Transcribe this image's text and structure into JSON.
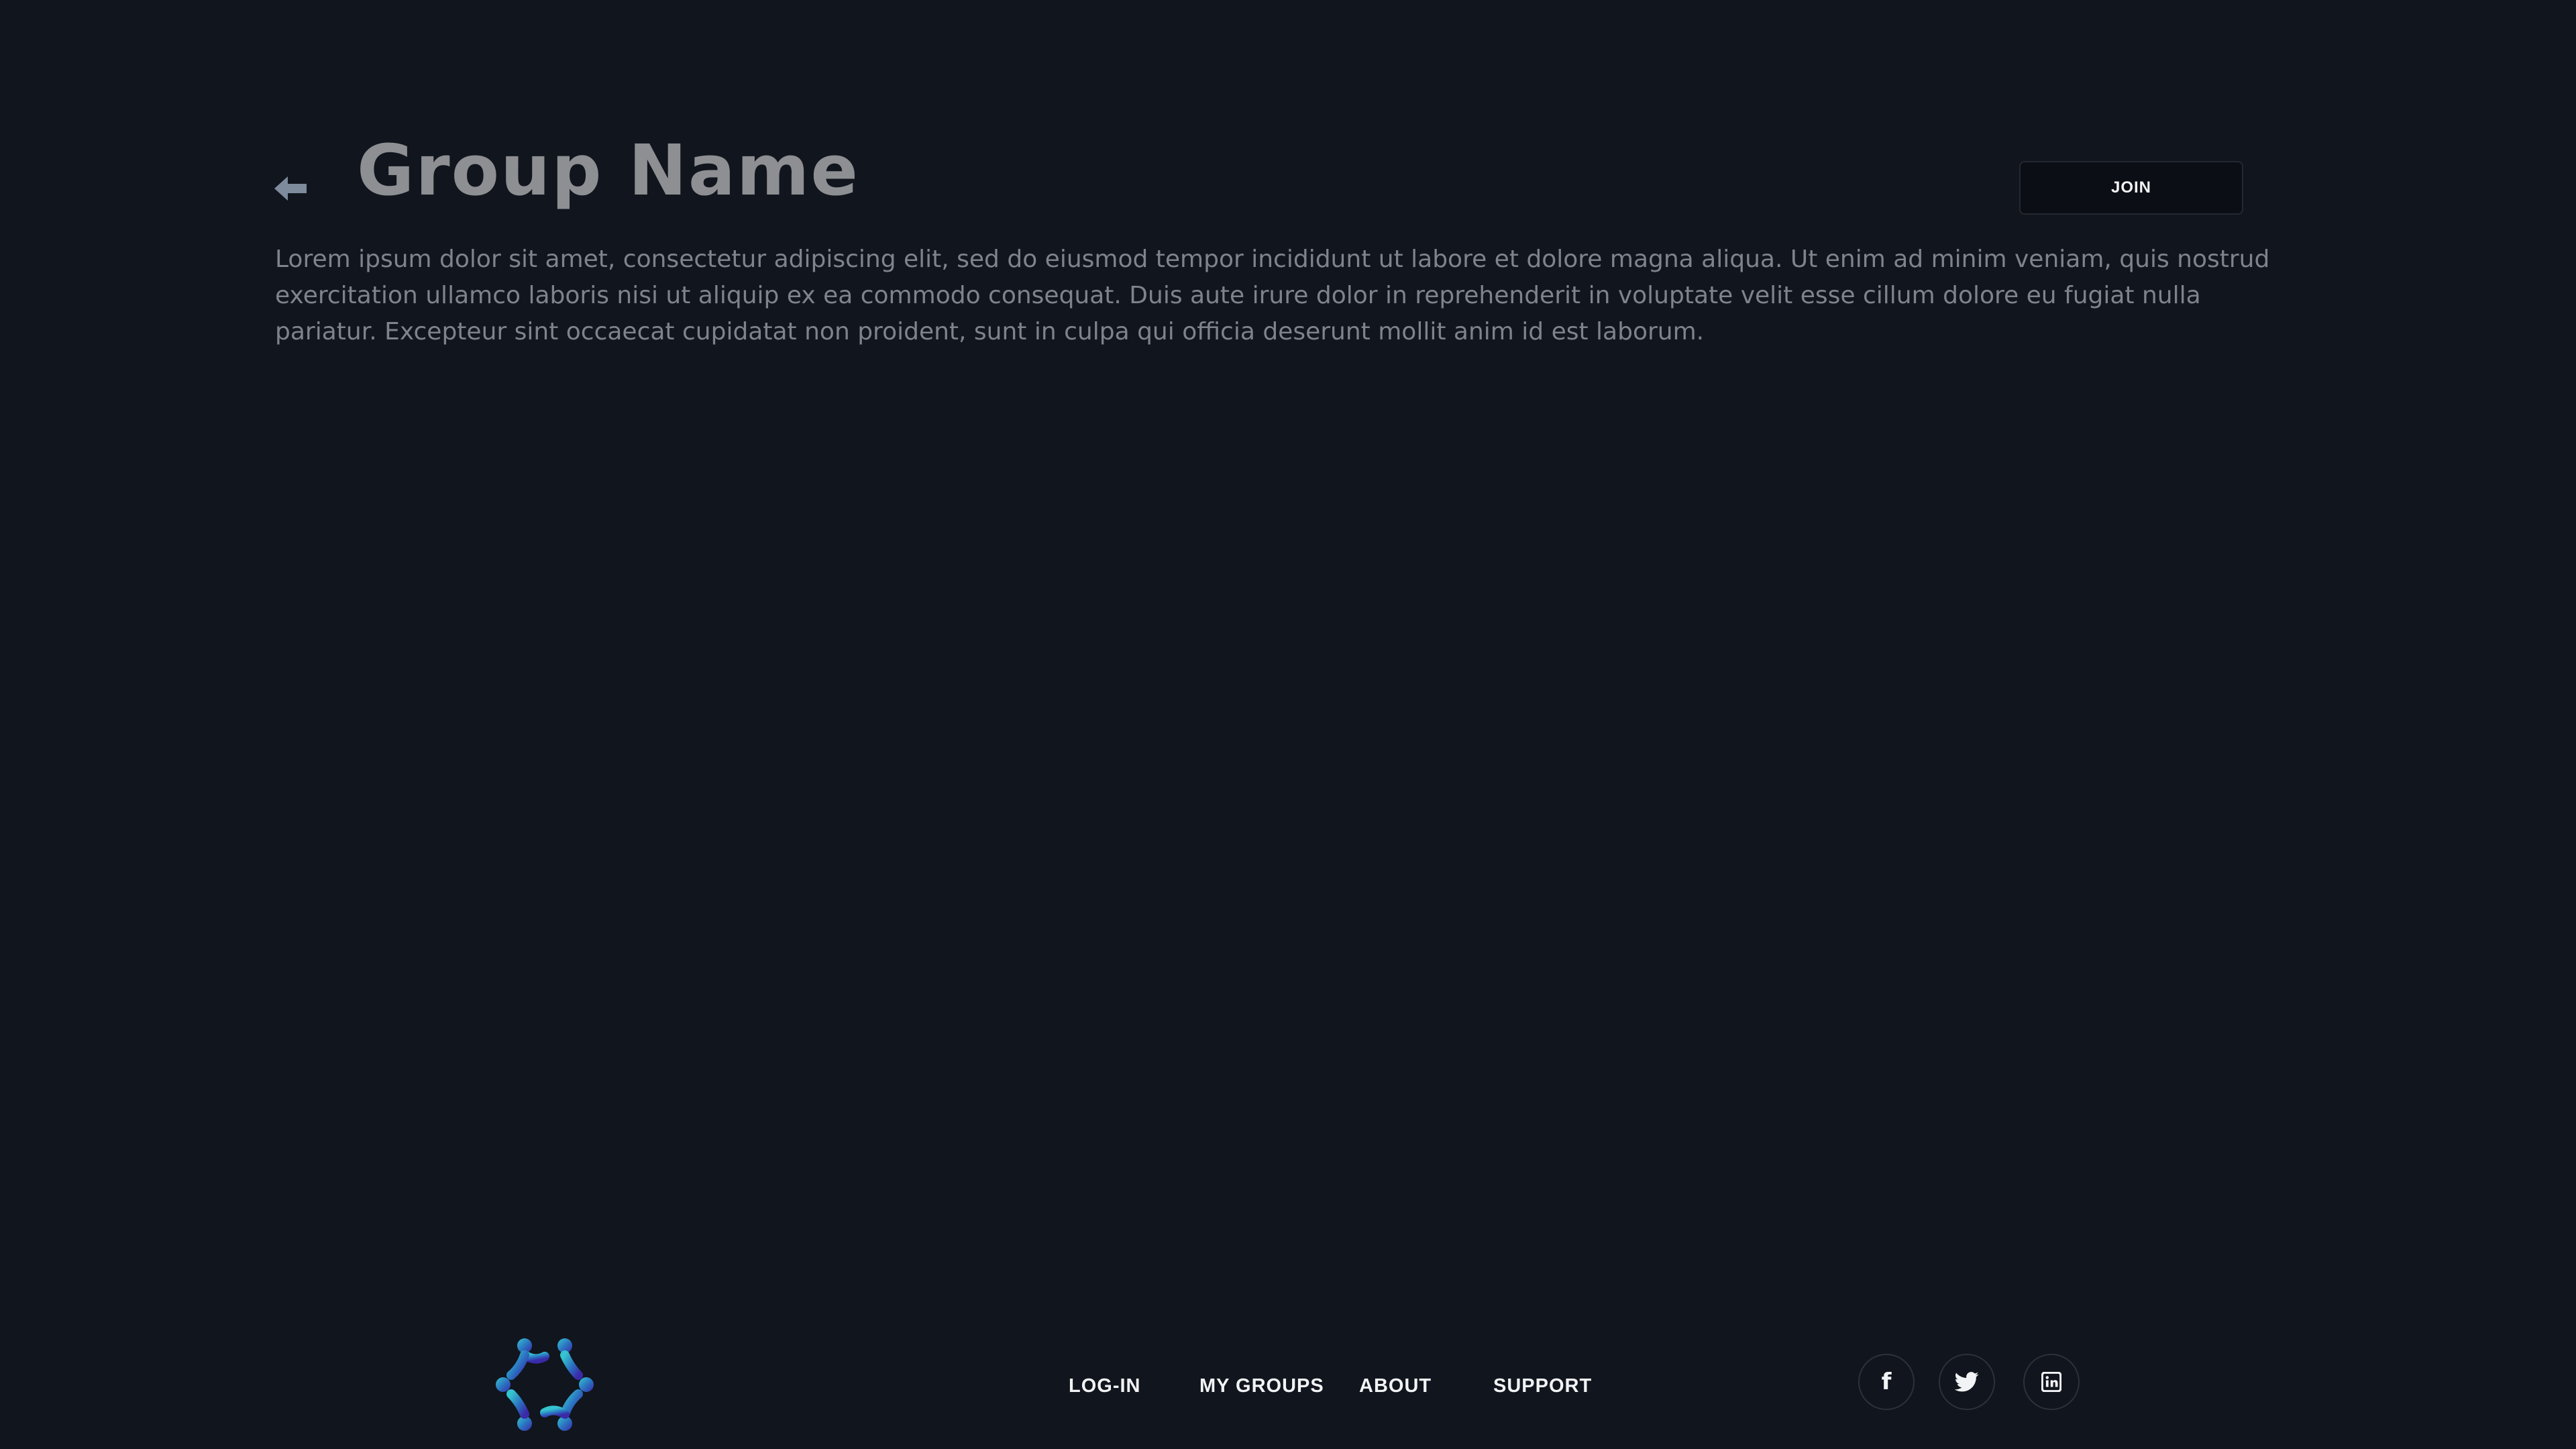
{
  "header": {
    "title": "Group Name",
    "back_icon": "arrow-left-icon",
    "join_label": "JOIN"
  },
  "main": {
    "description": "Lorem ipsum dolor sit amet, consectetur adipiscing elit, sed do eiusmod tempor incididunt ut labore et dolore magna aliqua. Ut enim ad minim veniam, quis nostrud exercitation ullamco laboris nisi ut aliquip ex ea commodo consequat. Duis aute irure dolor in reprehenderit in voluptate velit esse cillum dolore eu fugiat nulla pariatur. Excepteur sint occaecat cupidatat non proident, sunt in culpa qui officia deserunt mollit anim id est laborum."
  },
  "footer": {
    "logo_icon": "community-logo-icon",
    "links": [
      {
        "label": "LOG-IN"
      },
      {
        "label": "MY GROUPS"
      },
      {
        "label": "ABOUT"
      },
      {
        "label": "SUPPORT"
      }
    ],
    "social": [
      {
        "icon": "facebook-icon",
        "glyph": "f"
      },
      {
        "icon": "twitter-icon",
        "glyph": ""
      },
      {
        "icon": "linkedin-icon",
        "glyph": ""
      }
    ]
  },
  "colors": {
    "background": "#11151d",
    "title": "#8d8f93",
    "body_text": "#7f838b",
    "back_arrow": "#7d8b9c",
    "logo_teal": "#2fb7c9",
    "logo_blue": "#2b44b5",
    "logo_indigo": "#3a2aa8"
  }
}
